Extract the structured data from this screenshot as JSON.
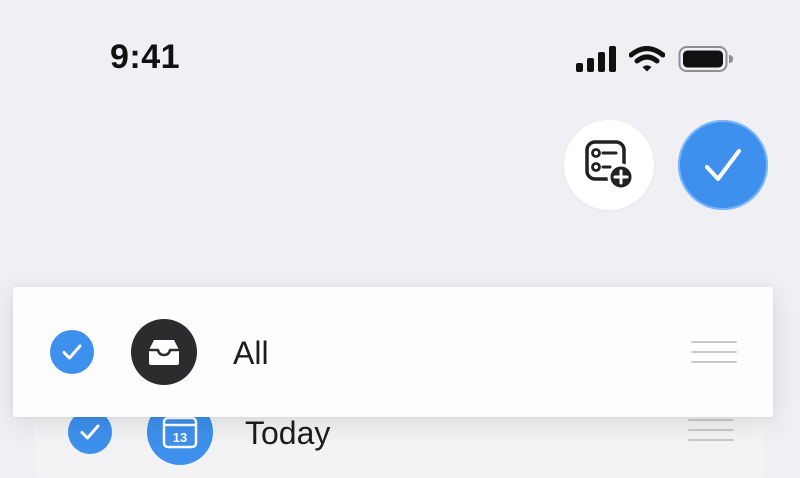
{
  "status_bar": {
    "time": "9:41",
    "icons": [
      "cellular-signal-icon",
      "wifi-icon",
      "battery-icon"
    ]
  },
  "actions": {
    "add_list_icon": "list-add-icon",
    "done_icon": "checkmark-icon"
  },
  "lists": [
    {
      "label": "All",
      "checked": true,
      "icon": "tray-icon",
      "icon_color": "#2c2c2e"
    },
    {
      "label": "Today",
      "checked": true,
      "icon": "calendar-icon",
      "icon_text": "13",
      "icon_color": "#3d90ec"
    }
  ],
  "colors": {
    "accent": "#3d90ec",
    "background": "#efeff4",
    "card": "#fdfdfd"
  }
}
